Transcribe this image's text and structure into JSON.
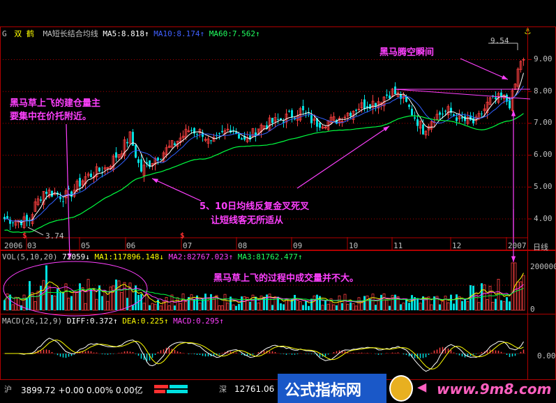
{
  "header": {
    "code_mark": "G",
    "stock_name": "双 鹤",
    "indicator_name": "MA短长结合均线",
    "ma5_label": "MA5:8.818",
    "ma10_label": "MA10:8.174",
    "ma60_label": "MA60:7.562",
    "arrow_up": "↑",
    "arrow_down": "↓"
  },
  "colors": {
    "up": "#ff4040",
    "down": "#00e0e0",
    "ma5": "#ffffff",
    "ma10": "#3060ff",
    "ma60": "#00ff40",
    "grid": "#b00000",
    "annotation": "#ff40ff",
    "ma_label_blue": "#4060ff",
    "ma_label_green": "#20ff60",
    "vol_ma1": "#ffff00",
    "vol_ma2": "#ff40ff",
    "vol_ma3": "#00ff40"
  },
  "price_axis": {
    "ticks": [
      "9.00",
      "8.00",
      "7.00",
      "6.00",
      "5.00",
      "4.00"
    ],
    "high_label": "9.54",
    "low_label": "3.74"
  },
  "time_axis": {
    "labels": [
      "2006",
      "03",
      "05",
      "06",
      "07",
      "08",
      "09",
      "10",
      "11",
      "12",
      "2007"
    ],
    "period": "日线"
  },
  "volume_panel": {
    "label": "VOL(5,10,20)",
    "vol_value": "72059",
    "ma1": "MA1:117896.148",
    "ma2": "MA2:82767.023",
    "ma3": "MA3:81762.477",
    "ticks": [
      "200000",
      "0"
    ]
  },
  "macd_panel": {
    "label": "MACD(26,12,9)",
    "diff": "DIFF:0.372",
    "dea": "DEA:0.225",
    "macd": "MACD:0.295",
    "tick": "0.00"
  },
  "annotations": {
    "top_right": "黑马腾空瞬间",
    "left_line1": "黑马草上飞的建仓量主",
    "left_line2": "要集中在价托附近。",
    "middle_line1": "5、10日均线反复金叉死叉",
    "middle_line2": "让短线客无所适从",
    "volume_note": "黑马草上飞的过程中成交量并不大。"
  },
  "status_bar": {
    "sh_label": "沪",
    "sh_quote": "3899.72 +0.00 0.00% 0.00亿",
    "sz_label": "深",
    "sz_quote": "12761.06"
  },
  "watermark": {
    "text": "公式指标网",
    "url": "www.9m8.com"
  },
  "chart_data": {
    "type": "candlestick",
    "price_range": [
      3.5,
      9.8
    ],
    "start_price": 4.0,
    "low_value": 3.74,
    "high_value": 9.54,
    "grid": true
  }
}
